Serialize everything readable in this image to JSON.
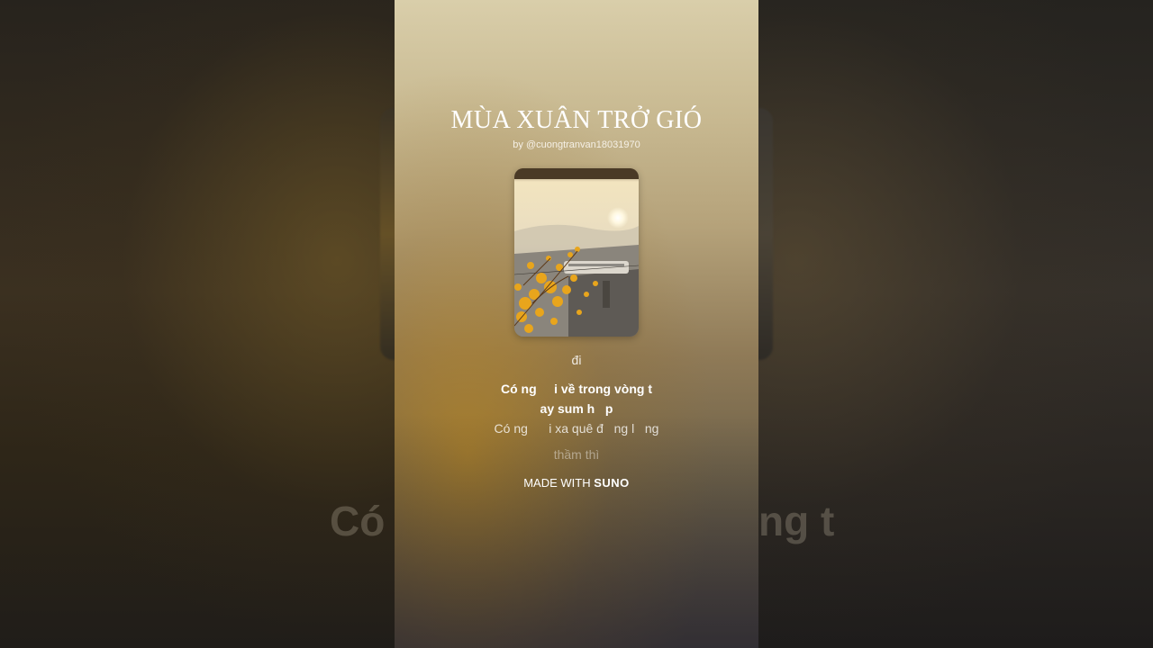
{
  "background": {
    "big_lyric_left": "Có",
    "big_lyric_right": "ng t"
  },
  "song": {
    "title": "MÙA XUÂN TRỞ GIÓ",
    "byline": "by @cuongtranvan18031970"
  },
  "cover": {
    "icon": "album-cover-image"
  },
  "lyrics": {
    "previous": "đi",
    "current_line1": "Có ng     i về trong vòng t",
    "current_line2": "ay sum h   p",
    "next": "Có ng      i xa quê đ   ng l   ng",
    "next2": "thầm thì"
  },
  "footer": {
    "made_with": "MADE WITH",
    "brand": "SUNO"
  },
  "colors": {
    "accent": "#d4a21a",
    "text": "#ffffff"
  }
}
